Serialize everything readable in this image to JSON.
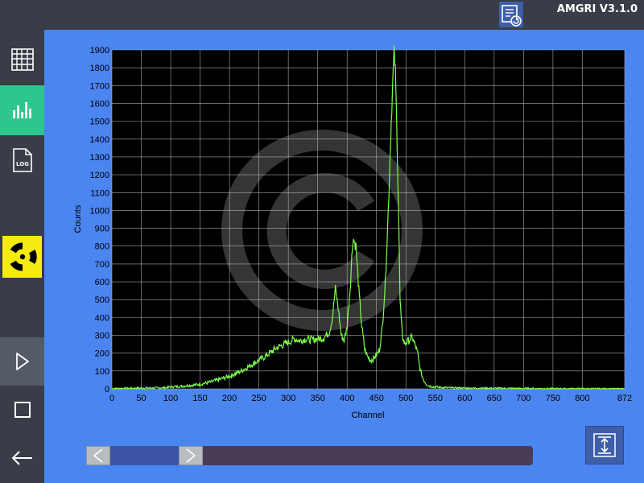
{
  "app": {
    "title": "AMGRI V3.1.0"
  },
  "icons": {
    "export": "export-refresh-icon",
    "table": "grid-table-icon",
    "spectrum": "spectrum-bars-icon",
    "log": "log-file-icon",
    "log_text": "LOG",
    "radiation": "radiation-icon",
    "play": "play-icon",
    "stop": "stop-icon",
    "back": "back-arrow-icon",
    "scale": "vertical-scale-icon"
  },
  "colors": {
    "accent": "#2fc68e",
    "background": "#4b85f0",
    "sidebar": "#383d47",
    "trace": "#7cff48",
    "radiation": "#f5eb11"
  },
  "slider": {
    "position": 0.12
  },
  "chart_data": {
    "type": "line",
    "xlabel": "Channel",
    "ylabel": "Counts",
    "xlim": [
      0,
      872
    ],
    "ylim": [
      0,
      1900
    ],
    "xticks": [
      "0",
      "50",
      "100",
      "150",
      "200",
      "250",
      "300",
      "350",
      "400",
      "450",
      "500",
      "550",
      "600",
      "650",
      "700",
      "750",
      "800",
      "872"
    ],
    "yticks": [
      "0",
      "100",
      "200",
      "300",
      "400",
      "500",
      "600",
      "700",
      "800",
      "900",
      "1000",
      "1100",
      "1200",
      "1300",
      "1400",
      "1500",
      "1600",
      "1700",
      "1800",
      "1900"
    ],
    "grid": true,
    "series": [
      {
        "x": [
          0,
          50,
          90,
          100,
          120,
          150,
          170,
          200,
          220,
          240,
          260,
          280,
          300,
          310,
          320,
          330,
          340,
          350,
          360,
          370,
          375,
          380,
          385,
          390,
          395,
          400,
          405,
          410,
          415,
          420,
          425,
          430,
          435,
          440,
          445,
          450,
          455,
          460,
          465,
          470,
          472,
          475,
          478,
          480,
          482,
          485,
          488,
          490,
          492,
          495,
          498,
          500,
          505,
          510,
          515,
          520,
          522,
          525,
          530,
          535,
          540,
          550,
          560,
          580,
          600,
          650,
          700,
          750,
          800,
          872
        ],
        "y": [
          2,
          4,
          6,
          10,
          15,
          25,
          40,
          70,
          100,
          140,
          180,
          230,
          260,
          280,
          270,
          280,
          275,
          280,
          285,
          320,
          400,
          560,
          450,
          300,
          270,
          350,
          560,
          850,
          800,
          550,
          350,
          220,
          180,
          160,
          170,
          190,
          220,
          350,
          600,
          1000,
          1200,
          1500,
          1750,
          1880,
          1780,
          1400,
          900,
          500,
          380,
          280,
          250,
          260,
          270,
          290,
          250,
          200,
          150,
          100,
          50,
          25,
          15,
          10,
          8,
          5,
          4,
          3,
          2,
          1,
          1,
          0
        ]
      }
    ]
  }
}
